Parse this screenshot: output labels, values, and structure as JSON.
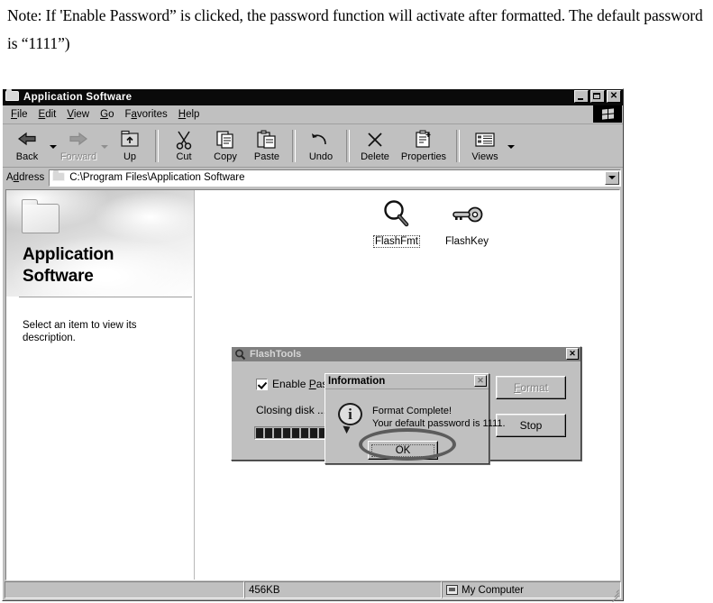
{
  "note": "Note: If 'Enable Password” is clicked, the password function will activate after formatted. The default password is “1111”)",
  "window": {
    "title": "Application Software",
    "icon": "folder-icon",
    "controls": {
      "minimize": "_",
      "maximize": "□",
      "close": "✕"
    }
  },
  "menu": {
    "items": [
      {
        "label": "File",
        "accel": "F"
      },
      {
        "label": "Edit",
        "accel": "E"
      },
      {
        "label": "View",
        "accel": "V"
      },
      {
        "label": "Go",
        "accel": "G"
      },
      {
        "label": "Favorites",
        "accel": "a"
      },
      {
        "label": "Help",
        "accel": "H"
      }
    ],
    "logo": "windows-flag-icon"
  },
  "toolbar": {
    "buttons": [
      {
        "label": "Back",
        "icon": "back-arrow-icon",
        "disabled": false,
        "has_caret": true
      },
      {
        "label": "Forward",
        "icon": "forward-arrow-icon",
        "disabled": true,
        "has_caret": true
      },
      {
        "label": "Up",
        "icon": "up-folder-icon",
        "disabled": false,
        "has_caret": false
      },
      {
        "label": "Cut",
        "icon": "scissors-icon",
        "disabled": false,
        "has_caret": false
      },
      {
        "label": "Copy",
        "icon": "copy-pages-icon",
        "disabled": false,
        "has_caret": false
      },
      {
        "label": "Paste",
        "icon": "clipboard-paste-icon",
        "disabled": false,
        "has_caret": false
      },
      {
        "label": "Undo",
        "icon": "undo-arrow-icon",
        "disabled": false,
        "has_caret": false
      },
      {
        "label": "Delete",
        "icon": "delete-x-icon",
        "disabled": false,
        "has_caret": false
      },
      {
        "label": "Properties",
        "icon": "properties-clipboard-icon",
        "disabled": false,
        "has_caret": false
      },
      {
        "label": "Views",
        "icon": "views-list-icon",
        "disabled": false,
        "has_caret": true
      }
    ]
  },
  "address": {
    "label": "Address",
    "accel": "d",
    "value": "C:\\Program Files\\Application Software",
    "icon": "folder-icon",
    "dropdown": "chevron-down-icon"
  },
  "left_pane": {
    "folder_icon": "large-folder-icon",
    "title": "Application Software",
    "description": "Select an item to view its description."
  },
  "files": [
    {
      "name": "FlashFmt",
      "icon": "magnifier-icon",
      "selected": true
    },
    {
      "name": "FlashKey",
      "icon": "key-icon",
      "selected": false
    }
  ],
  "status_bar": {
    "panel1": "",
    "panel2": "456KB",
    "panel3": "My Computer",
    "panel3_icon": "computer-icon"
  },
  "flashtools": {
    "title": "FlashTools",
    "icon": "magnifier-icon",
    "close": "✕",
    "checkbox": {
      "label": "Enable Pass",
      "accel": "P",
      "checked": true
    },
    "status": "Closing disk ...",
    "progress_blocks": 9,
    "buttons": [
      {
        "label": "Format",
        "accel": "F",
        "disabled": true
      },
      {
        "label": "Stop",
        "accel": "",
        "disabled": false
      }
    ]
  },
  "information_dialog": {
    "title": "Information",
    "close": "✕",
    "icon": "info-icon",
    "line1": "Format Complete!",
    "line2": "Your default password is 1111.",
    "ok_label": "OK",
    "annotation": "circle-highlight"
  },
  "colors": {
    "window_face": "#c0c0c0",
    "titlebar_active": "#0a0a0a",
    "titlebar_inactive": "#808080",
    "text": "#000000",
    "disabled_text": "#828282",
    "annotation": "#5c5c5c"
  }
}
